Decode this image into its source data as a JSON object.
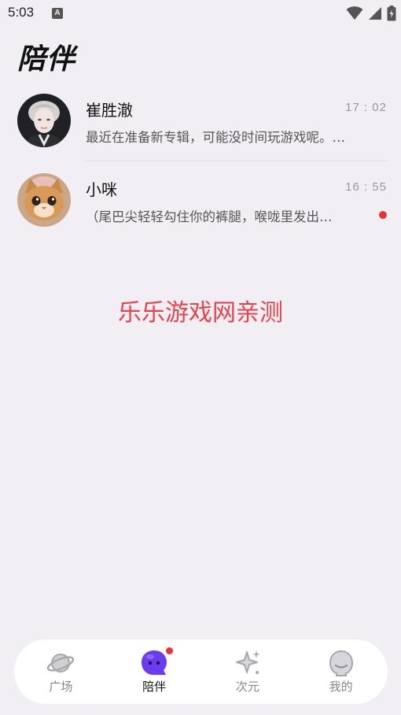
{
  "status_bar": {
    "time": "5:03"
  },
  "page": {
    "title": "陪伴"
  },
  "chats": [
    {
      "name": "崔胜澈",
      "time": "17 : 02",
      "preview": "最近在准备新专辑，可能没时间玩游戏呢。…",
      "unread": false
    },
    {
      "name": "小咪",
      "time": "16 : 55",
      "preview": "（尾巴尖轻轻勾住你的裤腿，喉咙里发出…",
      "unread": true
    }
  ],
  "watermark": "乐乐游戏网亲测",
  "nav": {
    "items": [
      {
        "label": "广场",
        "icon": "planet-icon",
        "active": false
      },
      {
        "label": "陪伴",
        "icon": "chat-bubble-icon",
        "active": true
      },
      {
        "label": "次元",
        "icon": "sparkle-icon",
        "active": false
      },
      {
        "label": "我的",
        "icon": "profile-face-icon",
        "active": false
      }
    ]
  },
  "colors": {
    "accent": "#6b3bf0",
    "badge": "#e8323a",
    "watermark": "#e8434a",
    "background": "#f1eff4"
  }
}
